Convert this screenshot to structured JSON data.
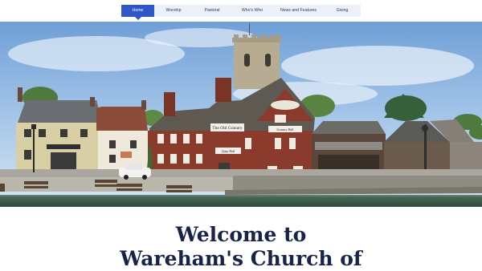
{
  "nav": {
    "items": [
      {
        "label": "Home",
        "active": true
      },
      {
        "label": "Worship",
        "active": false
      },
      {
        "label": "Pastoral",
        "active": false
      },
      {
        "label": "Who's Who",
        "active": false
      },
      {
        "label": "News and Features",
        "active": false
      },
      {
        "label": "Giving",
        "active": false
      }
    ]
  },
  "hero": {
    "signs": {
      "granary": "The Old Granary",
      "quay_inn": "The Quay Inn",
      "granary_sub": "Granary Hall",
      "quay_sub": "Quay Hall"
    }
  },
  "headline": {
    "line1": "Welcome to",
    "line2": "Wareham's Church of"
  },
  "colors": {
    "accent": "#2f57c6",
    "nav_bg": "#eef0f7",
    "headline": "#182349"
  }
}
